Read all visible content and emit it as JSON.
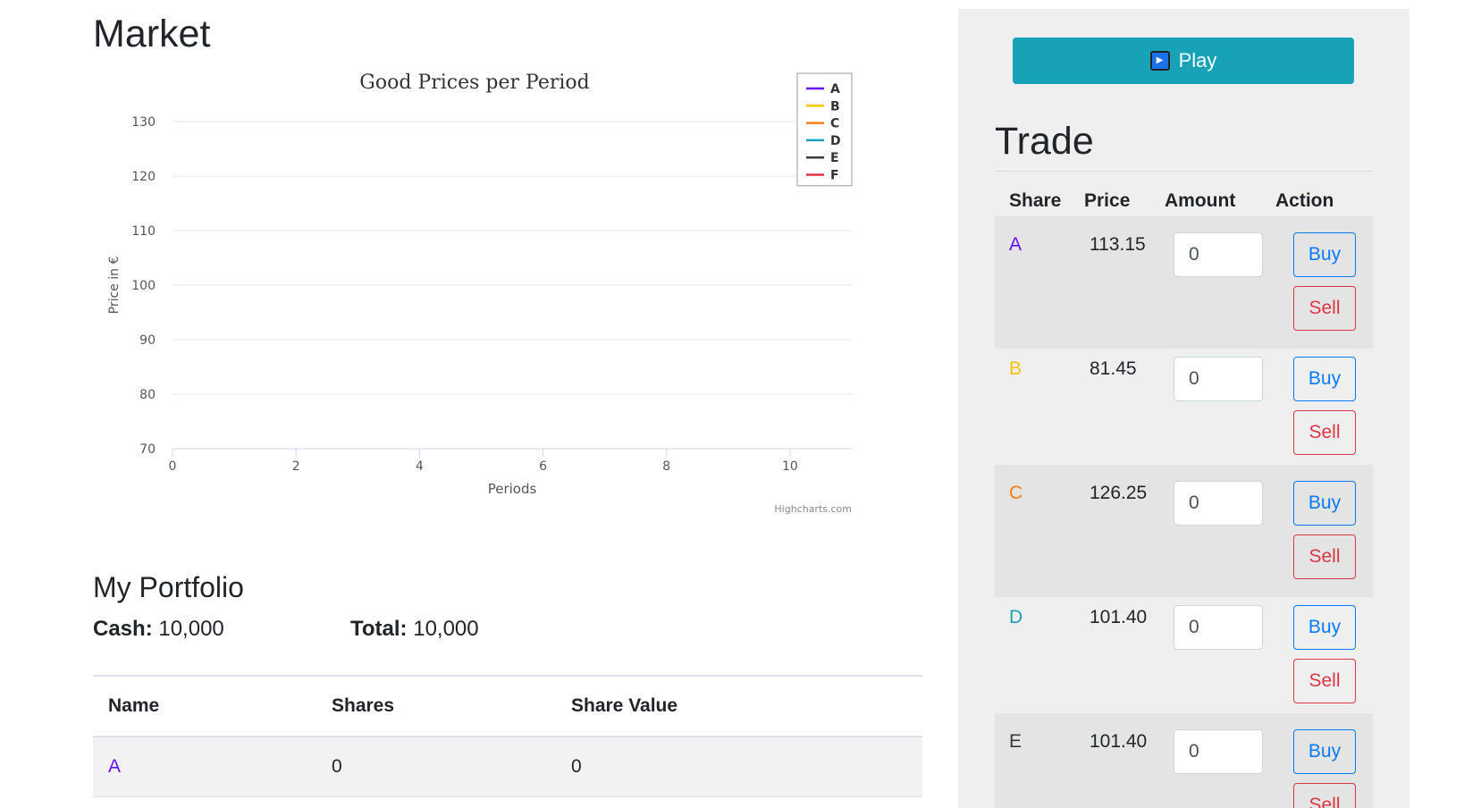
{
  "market": {
    "title": "Market",
    "credit": "Highcharts.com"
  },
  "chart_data": {
    "type": "line",
    "title": "Good Prices per Period",
    "xlabel": "Periods",
    "ylabel": "Price in €",
    "xlim": [
      0,
      11
    ],
    "ylim": [
      70,
      130
    ],
    "xticks": [
      0,
      2,
      4,
      6,
      8,
      10
    ],
    "yticks": [
      70,
      80,
      90,
      100,
      110,
      120,
      130
    ],
    "grid": true,
    "legend_position": "top-right",
    "series": [
      {
        "name": "A",
        "color": "#6610f2",
        "values": []
      },
      {
        "name": "B",
        "color": "#ffc107",
        "values": []
      },
      {
        "name": "C",
        "color": "#fd7e14",
        "values": []
      },
      {
        "name": "D",
        "color": "#17a2b8",
        "values": []
      },
      {
        "name": "E",
        "color": "#343a40",
        "values": []
      },
      {
        "name": "F",
        "color": "#dc3545",
        "values": []
      }
    ]
  },
  "portfolio": {
    "title": "My Portfolio",
    "cash_label": "Cash:",
    "cash_value": "10,000",
    "total_label": "Total:",
    "total_value": "10,000",
    "columns": [
      "Name",
      "Shares",
      "Share Value"
    ],
    "rows": [
      {
        "name": "A",
        "shares": "0",
        "value": "0",
        "color": "#6610f2"
      }
    ]
  },
  "trade": {
    "play_label": "Play",
    "title": "Trade",
    "columns": [
      "Share",
      "Price",
      "Amount",
      "Action"
    ],
    "buy_label": "Buy",
    "sell_label": "Sell",
    "rows": [
      {
        "share": "A",
        "price": "113.15",
        "amount": "0",
        "color": "#6610f2"
      },
      {
        "share": "B",
        "price": "81.45",
        "amount": "0",
        "color": "#ffc107"
      },
      {
        "share": "C",
        "price": "126.25",
        "amount": "0",
        "color": "#fd7e14"
      },
      {
        "share": "D",
        "price": "101.40",
        "amount": "0",
        "color": "#17a2b8"
      },
      {
        "share": "E",
        "price": "101.40",
        "amount": "0",
        "color": "#343a40"
      }
    ]
  }
}
